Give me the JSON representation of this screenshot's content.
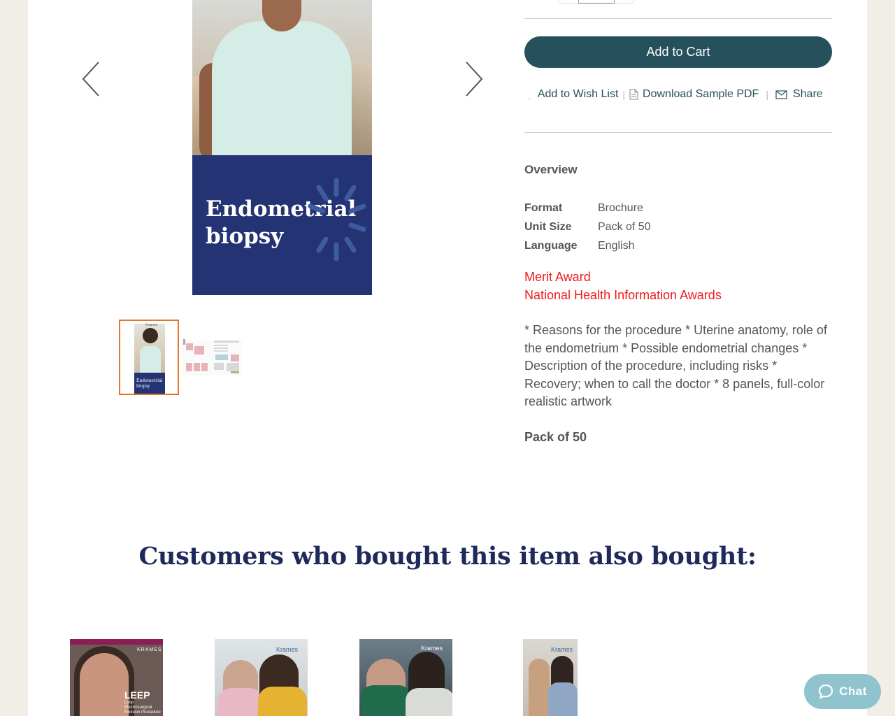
{
  "gallery": {
    "cover_title": "Endometrial\nbiopsy",
    "thumb_title": "Endometrial biopsy",
    "thumb_brand": "Krames",
    "prev_icon": "chevron-left-icon",
    "next_icon": "chevron-right-icon"
  },
  "product": {
    "add_to_cart": "Add to Cart",
    "actions": {
      "wishlist": "Add to Wish List",
      "sample_pdf": "Download Sample PDF",
      "share": "Share",
      "separator": "|"
    },
    "overview_title": "Overview",
    "specs": [
      {
        "key": "Format",
        "value": "Brochure"
      },
      {
        "key": "Unit Size",
        "value": "Pack of 50"
      },
      {
        "key": "Language",
        "value": "English"
      }
    ],
    "awards": [
      "Merit Award",
      "National Health Information Awards"
    ],
    "description": "* Reasons for the procedure * Uterine anatomy, role of the endometrium * Possible endometrial changes * Description of the procedure, including risks * Recovery; when to call the doctor * 8 panels, full-color realistic artwork",
    "pack": "Pack of 50"
  },
  "recommendations": {
    "title": "Customers who bought this item also bought:",
    "items": [
      {
        "brand": "KRAMES",
        "label": "LEEP",
        "sub": "Loop Electrosurgical Excision Procedure"
      },
      {
        "brand": "Krames"
      },
      {
        "brand": "Krames"
      },
      {
        "brand": "Krames"
      }
    ]
  },
  "chat": {
    "label": "Chat",
    "icon": "chat-bubble-icon"
  },
  "colors": {
    "accent": "#26515c",
    "award": "#ee1c1c",
    "heading": "#1e2a5a",
    "cover_band": "#243373",
    "chat": "#8fc4cf",
    "thumb_selected": "#e8742c"
  }
}
